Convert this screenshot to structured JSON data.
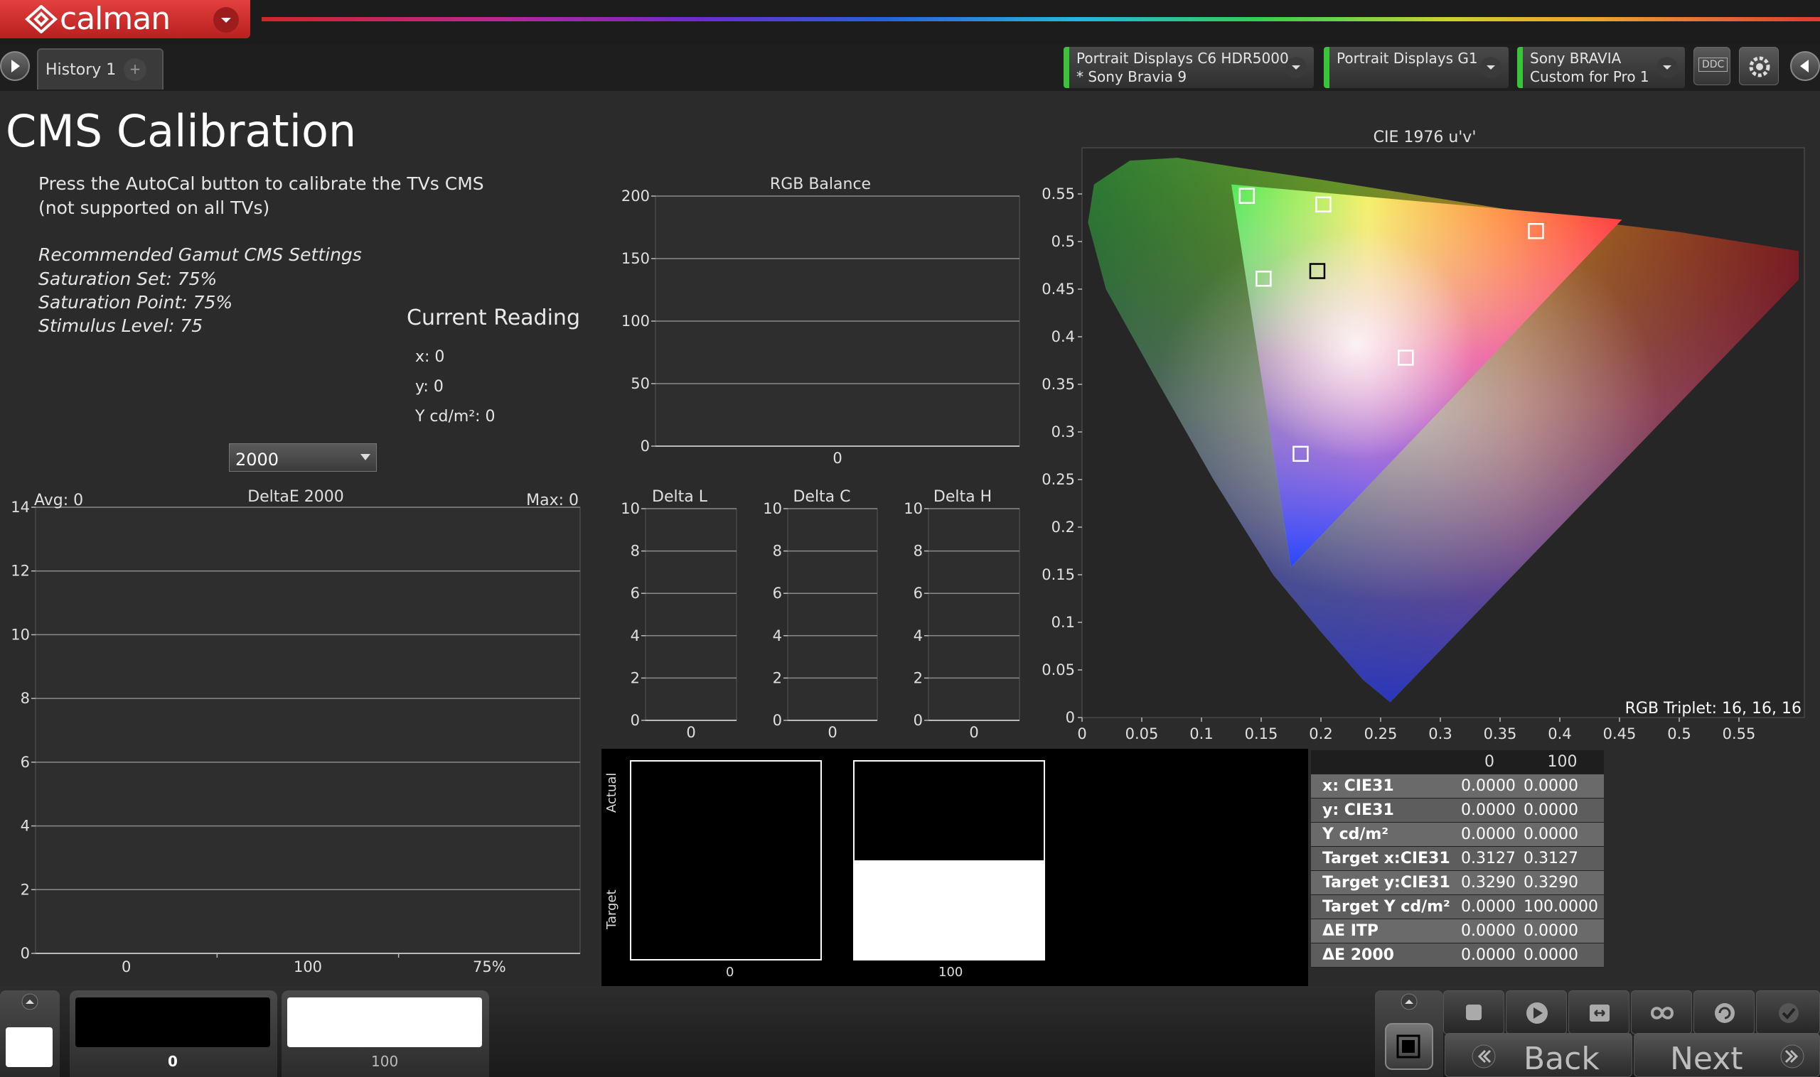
{
  "app": {
    "logo_text": "calman",
    "brand_color": "#d2302f"
  },
  "tabs": {
    "history_label": "History 1",
    "add_icon": "plus-icon"
  },
  "devices": [
    {
      "line1": "Portrait Displays C6 HDR5000",
      "line2": "* Sony Bravia 9"
    },
    {
      "line1": "Portrait Displays G1",
      "line2": ""
    },
    {
      "line1": "Sony BRAVIA",
      "line2": "Custom for Pro 1"
    }
  ],
  "toolbar": {
    "ddc_label": "DDC"
  },
  "page": {
    "title": "CMS Calibration",
    "instruction_1": "Press the AutoCal button to calibrate the TVs CMS",
    "instruction_2": "(not supported on all TVs)",
    "rec_title": "Recommended Gamut CMS Settings",
    "rec_saturation_set": "Saturation Set: 75%",
    "rec_saturation_point": "Saturation Point: 75%",
    "rec_stimulus": "Stimulus Level: 75"
  },
  "current_reading": {
    "title": "Current Reading",
    "x": "x: 0",
    "y": "y: 0",
    "Y": "Y cd/m²: 0"
  },
  "deltae_select": {
    "value": "2000"
  },
  "chart_data": [
    {
      "type": "bar",
      "title": "DeltaE 2000",
      "avg_label": "Avg: 0",
      "max_label": "Max: 0",
      "categories": [
        "0",
        "100",
        "75%"
      ],
      "values": [
        0,
        0,
        0
      ],
      "ylim": [
        0,
        14
      ],
      "yticks": [
        "0",
        "2",
        "4",
        "6",
        "8",
        "10",
        "12",
        "14"
      ],
      "grid": true
    },
    {
      "type": "bar",
      "title": "RGB Balance",
      "categories": [
        "0"
      ],
      "values": [
        0
      ],
      "ylim": [
        0,
        200
      ],
      "yticks": [
        "0",
        "50",
        "100",
        "150",
        "200"
      ],
      "grid": true
    },
    {
      "type": "bar",
      "title": "Delta L",
      "categories": [
        "0"
      ],
      "values": [
        0
      ],
      "ylim": [
        0,
        10
      ],
      "yticks": [
        "0",
        "2",
        "4",
        "6",
        "8",
        "10"
      ],
      "grid": true
    },
    {
      "type": "bar",
      "title": "Delta C",
      "categories": [
        "0"
      ],
      "values": [
        0
      ],
      "ylim": [
        0,
        10
      ],
      "yticks": [
        "0",
        "2",
        "4",
        "6",
        "8",
        "10"
      ],
      "grid": true
    },
    {
      "type": "bar",
      "title": "Delta H",
      "categories": [
        "0"
      ],
      "values": [
        0
      ],
      "ylim": [
        0,
        10
      ],
      "yticks": [
        "0",
        "2",
        "4",
        "6",
        "8",
        "10"
      ],
      "grid": true
    },
    {
      "type": "scatter",
      "title": "CIE 1976 u'v'",
      "annotation": "RGB Triplet: 16, 16, 16",
      "xlim": [
        0,
        0.6
      ],
      "ylim": [
        0,
        0.6
      ],
      "xticks": [
        "0",
        "0.05",
        "0.1",
        "0.15",
        "0.2",
        "0.25",
        "0.3",
        "0.35",
        "0.4",
        "0.45",
        "0.5",
        "0.55"
      ],
      "yticks": [
        "0",
        "0.05",
        "0.1",
        "0.15",
        "0.2",
        "0.25",
        "0.3",
        "0.35",
        "0.4",
        "0.45",
        "0.5",
        "0.55"
      ],
      "gamut_triangle": [
        [
          0.125,
          0.56
        ],
        [
          0.452,
          0.523
        ],
        [
          0.175,
          0.158
        ]
      ],
      "target_points": [
        {
          "u": 0.138,
          "v": 0.548,
          "color": "#ffffff"
        },
        {
          "u": 0.202,
          "v": 0.539,
          "color": "#ffffff"
        },
        {
          "u": 0.38,
          "v": 0.511,
          "color": "#ffffff"
        },
        {
          "u": 0.152,
          "v": 0.461,
          "color": "#ffffff"
        },
        {
          "u": 0.197,
          "v": 0.469,
          "color": "#000000"
        },
        {
          "u": 0.271,
          "v": 0.378,
          "color": "#ffffff"
        },
        {
          "u": 0.183,
          "v": 0.277,
          "color": "#ffffff"
        }
      ]
    }
  ],
  "swatches": {
    "actual_label": "Actual",
    "target_label": "Target",
    "items": [
      {
        "label": "0"
      },
      {
        "label": "100"
      }
    ]
  },
  "meas_table": {
    "columns": [
      "0",
      "100"
    ],
    "rows": [
      {
        "label": "x: CIE31",
        "v0": "0.0000",
        "v1": "0.0000"
      },
      {
        "label": "y: CIE31",
        "v0": "0.0000",
        "v1": "0.0000"
      },
      {
        "label": "Y cd/m²",
        "v0": "0.0000",
        "v1": "0.0000"
      },
      {
        "label": "Target x:CIE31",
        "v0": "0.3127",
        "v1": "0.3127"
      },
      {
        "label": "Target y:CIE31",
        "v0": "0.3290",
        "v1": "0.3290"
      },
      {
        "label": "Target Y cd/m²",
        "v0": "0.0000",
        "v1": "100.0000"
      },
      {
        "label": "ΔE ITP",
        "v0": "0.0000",
        "v1": "0.0000"
      },
      {
        "label": "ΔE 2000",
        "v0": "0.0000",
        "v1": "0.0000"
      }
    ]
  },
  "bottom": {
    "thumbs": [
      {
        "label": "0"
      },
      {
        "label": "100"
      }
    ],
    "back_label": "Back",
    "next_label": "Next",
    "controls": [
      "stop-icon",
      "play-icon",
      "fit-icon",
      "infinity-icon",
      "refresh-icon",
      "check-icon"
    ]
  }
}
